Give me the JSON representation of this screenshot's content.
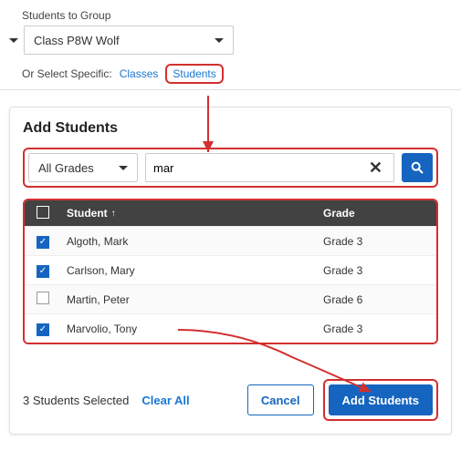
{
  "top": {
    "label": "Students to Group",
    "selected_group": "Class P8W Wolf",
    "specific_prefix": "Or Select Specific:",
    "classes_link": "Classes",
    "students_link": "Students"
  },
  "card": {
    "title": "Add Students",
    "grades_filter": "All Grades",
    "search_value": "mar",
    "columns": {
      "student": "Student",
      "grade": "Grade"
    },
    "rows": [
      {
        "checked": true,
        "name": "Algoth, Mark",
        "grade": "Grade 3"
      },
      {
        "checked": true,
        "name": "Carlson, Mary",
        "grade": "Grade 3"
      },
      {
        "checked": false,
        "name": "Martin, Peter",
        "grade": "Grade 6"
      },
      {
        "checked": true,
        "name": "Marvolio, Tony",
        "grade": "Grade 3"
      }
    ],
    "selected_text": "3 Students Selected",
    "clear_all": "Clear All",
    "cancel": "Cancel",
    "add": "Add Students"
  }
}
